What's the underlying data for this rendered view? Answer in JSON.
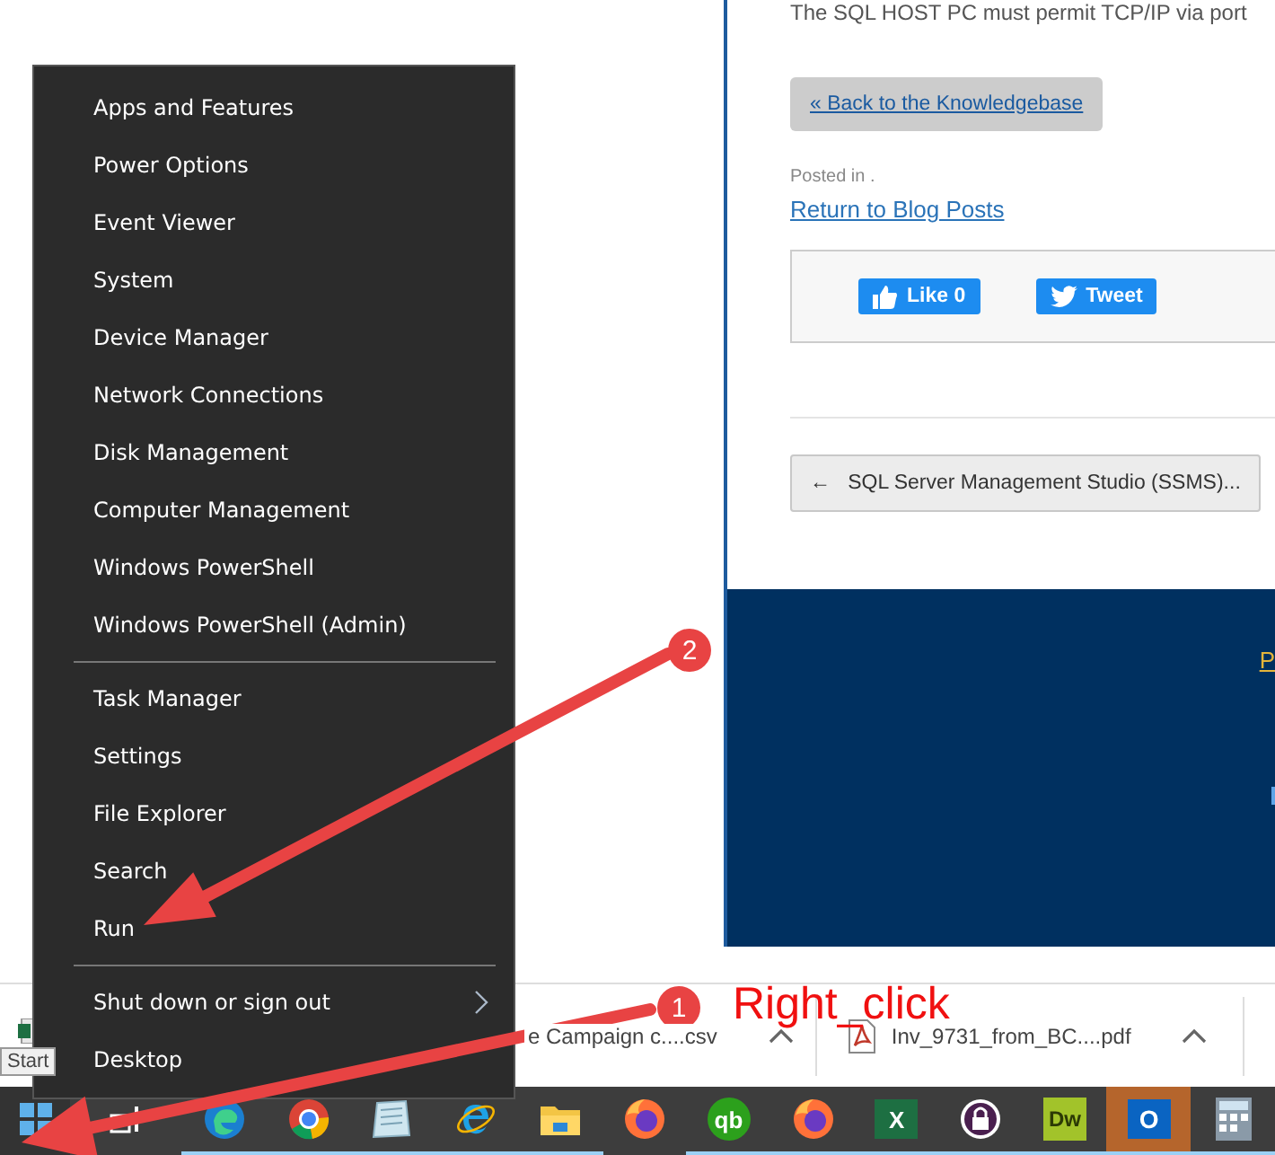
{
  "page": {
    "intro_text": "The SQL HOST PC must permit TCP/IP via port",
    "back_button": "« Back to the Knowledgebase",
    "posted_in": "Posted in .",
    "blog_link": "Return to Blog Posts",
    "share": [
      {
        "kind": "like",
        "label": "Like 0"
      },
      {
        "kind": "tweet",
        "label": "Tweet"
      }
    ],
    "prev_post_button": "←   SQL Server Management Studio (SSMS)...",
    "footer_link": "P"
  },
  "context_menu": {
    "groups": [
      [
        {
          "label": "Apps and Features",
          "has_submenu": false
        },
        {
          "label": "Power Options",
          "has_submenu": false
        },
        {
          "label": "Event Viewer",
          "has_submenu": false
        },
        {
          "label": "System",
          "has_submenu": false
        },
        {
          "label": "Device Manager",
          "has_submenu": false
        },
        {
          "label": "Network Connections",
          "has_submenu": false
        },
        {
          "label": "Disk Management",
          "has_submenu": false
        },
        {
          "label": "Computer Management",
          "has_submenu": false
        },
        {
          "label": "Windows PowerShell",
          "has_submenu": false
        },
        {
          "label": "Windows PowerShell (Admin)",
          "has_submenu": false
        }
      ],
      [
        {
          "label": "Task Manager",
          "has_submenu": false
        },
        {
          "label": "Settings",
          "has_submenu": false
        },
        {
          "label": "File Explorer",
          "has_submenu": false
        },
        {
          "label": "Search",
          "has_submenu": false
        },
        {
          "label": "Run",
          "has_submenu": false
        }
      ],
      [
        {
          "label": "Shut down or sign out",
          "has_submenu": true
        },
        {
          "label": "Desktop",
          "has_submenu": false
        }
      ]
    ]
  },
  "downloads": [
    {
      "kind": "csv",
      "name": "e Campaign c....csv"
    },
    {
      "kind": "pdf",
      "name": "Inv_9731_from_BC....pdf"
    }
  ],
  "tooltip": "Start",
  "taskbar": [
    {
      "kind": "start",
      "running": false,
      "selected": false
    },
    {
      "kind": "taskview",
      "running": false,
      "selected": false
    },
    {
      "kind": "edge",
      "running": true,
      "selected": false
    },
    {
      "kind": "chrome",
      "running": true,
      "selected": false
    },
    {
      "kind": "notepad",
      "running": true,
      "selected": false
    },
    {
      "kind": "ie",
      "running": true,
      "selected": false
    },
    {
      "kind": "folder",
      "running": true,
      "selected": false
    },
    {
      "kind": "firefox",
      "running": false,
      "selected": false
    },
    {
      "kind": "qb",
      "running": true,
      "selected": false,
      "icon_text": "qb"
    },
    {
      "kind": "firefox",
      "running": true,
      "selected": false
    },
    {
      "kind": "excel",
      "running": true,
      "selected": false,
      "icon_text": "X"
    },
    {
      "kind": "lock",
      "running": true,
      "selected": false
    },
    {
      "kind": "dw",
      "running": true,
      "selected": false,
      "icon_text": "Dw"
    },
    {
      "kind": "outlook",
      "running": true,
      "selected": true,
      "icon_text": "O"
    },
    {
      "kind": "calculator",
      "running": true,
      "selected": false
    }
  ],
  "annotations": [
    {
      "kind": "to_run",
      "number": "2"
    },
    {
      "kind": "to_start",
      "number": "1",
      "label": "Right_click"
    }
  ]
}
